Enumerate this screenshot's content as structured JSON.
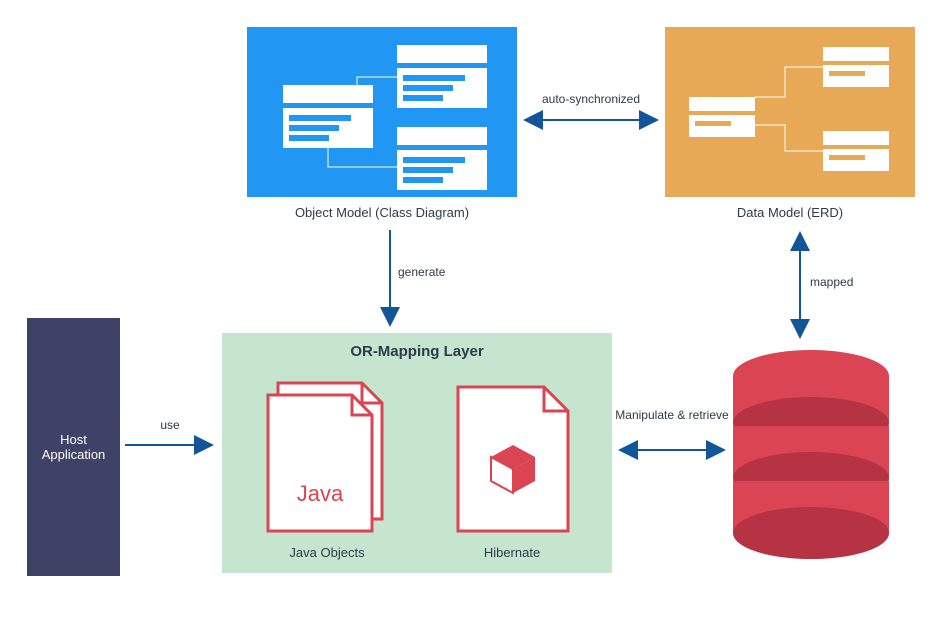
{
  "boxes": {
    "object_model": {
      "title": "Object Model (Class Diagram)"
    },
    "data_model": {
      "title": "Data Model (ERD)"
    },
    "or_layer": {
      "title": "OR-Mapping Layer",
      "java_label": "Java Objects",
      "java_text": "Java",
      "hibernate_label": "Hibernate"
    },
    "host_app": {
      "title": "Host Application"
    }
  },
  "arrows": {
    "auto_sync": "auto-synchronized",
    "generate": "generate",
    "mapped": "mapped",
    "manipulate": "Manipulate & retrieve",
    "use": "use"
  },
  "colors": {
    "blue_box": "#2196f3",
    "orange_box": "#e8a957",
    "green_box": "#c5e5cf",
    "navy_box": "#3d4266",
    "arrow": "#125699",
    "db": "#da4453",
    "doc_border": "#da4453",
    "doc_fill": "#ffffff"
  }
}
